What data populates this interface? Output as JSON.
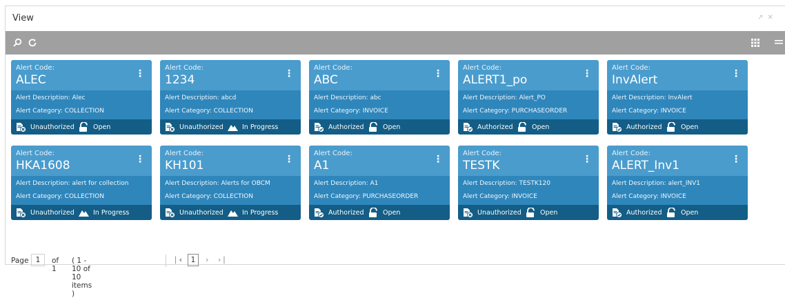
{
  "window": {
    "title": "View",
    "icons": [
      "expand-icon",
      "close-icon"
    ]
  },
  "toolbar": {
    "left_icons": [
      "search-icon",
      "refresh-icon"
    ],
    "right_icons": [
      "grid-view-icon",
      "list-view-icon"
    ]
  },
  "card_labels": {
    "code": "Alert Code:",
    "description": "Alert Description:",
    "category": "Alert Category:"
  },
  "cards": [
    {
      "code": "ALEC",
      "description": "Alec",
      "category": "COLLECTION",
      "auth": "Unauthorized",
      "status": "Open"
    },
    {
      "code": "1234",
      "description": "abcd",
      "category": "COLLECTION",
      "auth": "Unauthorized",
      "status": "In Progress"
    },
    {
      "code": "ABC",
      "description": "abc",
      "category": "INVOICE",
      "auth": "Authorized",
      "status": "Open"
    },
    {
      "code": "ALERT1_po",
      "description": "Alert_PO",
      "category": "PURCHASEORDER",
      "auth": "Authorized",
      "status": "Open"
    },
    {
      "code": "InvAlert",
      "description": "InvAlert",
      "category": "INVOICE",
      "auth": "Authorized",
      "status": "Open"
    },
    {
      "code": "HKA1608",
      "description": "alert for collection",
      "category": "COLLECTION",
      "auth": "Unauthorized",
      "status": "In Progress"
    },
    {
      "code": "KH101",
      "description": "Alerts for OBCM",
      "category": "COLLECTION",
      "auth": "Unauthorized",
      "status": "In Progress"
    },
    {
      "code": "A1",
      "description": "A1",
      "category": "PURCHASEORDER",
      "auth": "Authorized",
      "status": "Open"
    },
    {
      "code": "TESTK",
      "description": "TESTK120",
      "category": "INVOICE",
      "auth": "Unauthorized",
      "status": "Open"
    },
    {
      "code": "ALERT_Inv1",
      "description": "alert_INV1",
      "category": "INVOICE",
      "auth": "Authorized",
      "status": "Open"
    }
  ],
  "pager": {
    "page_label": "Page",
    "page_value": "1",
    "of_label": "of 1",
    "range": "( 1 - 10 of 10 items )",
    "current_page": "1"
  },
  "colors": {
    "card_head": "#4a9ccd",
    "card_body": "#2f86bb",
    "card_foot": "#135d86",
    "toolbar": "#a0a0a0"
  }
}
